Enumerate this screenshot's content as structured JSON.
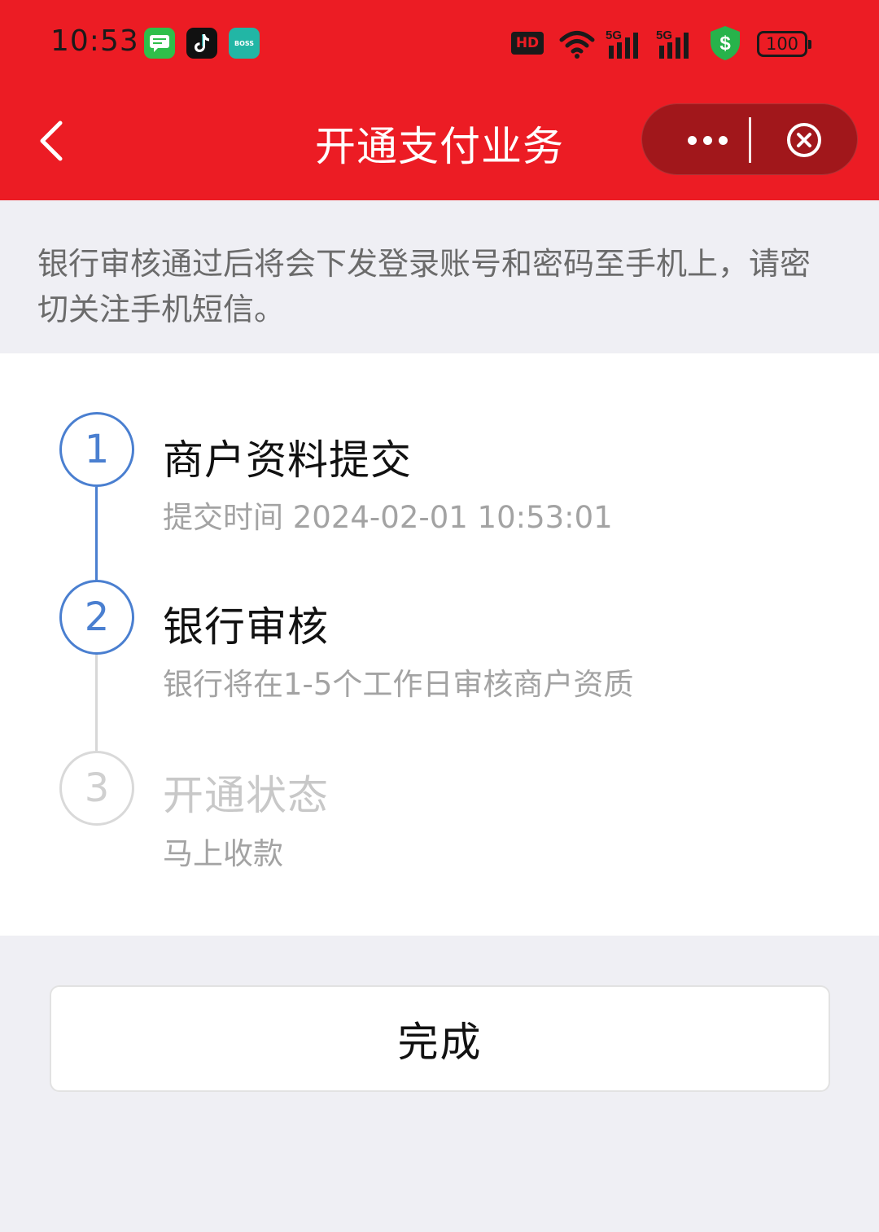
{
  "status_bar": {
    "time": "10:53",
    "battery": "100",
    "hd_label": "HD",
    "boss_app_label": "BOSS",
    "icons": [
      "messages-icon",
      "tiktok-icon",
      "boss-app-icon",
      "hd-icon",
      "wifi-icon",
      "5g-signal-icon",
      "5g-signal-icon",
      "security-shield-icon",
      "battery-icon"
    ]
  },
  "nav": {
    "title": "开通支付业务",
    "back_icon": "chevron-left-icon",
    "more_icon": "more-dots-icon",
    "close_icon": "close-circle-icon"
  },
  "notice": {
    "text": "银行审核通过后将会下发登录账号和密码至手机上，请密切关注手机短信。"
  },
  "steps": [
    {
      "number": "1",
      "title": "商户资料提交",
      "desc": "提交时间 2024-02-01 10:53:01",
      "state": "done"
    },
    {
      "number": "2",
      "title": "银行审核",
      "desc": "银行将在1-5个工作日审核商户资质",
      "state": "current"
    },
    {
      "number": "3",
      "title": "开通状态",
      "desc": "马上收款",
      "state": "pending"
    }
  ],
  "colors": {
    "header_red": "#ec1c24",
    "step_active_blue": "#4a7fd0",
    "step_inactive_gray": "#d9d9d9",
    "page_bg": "#efeff4"
  },
  "done_button": {
    "label": "完成"
  }
}
